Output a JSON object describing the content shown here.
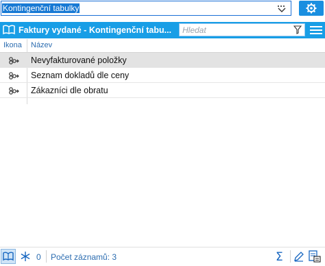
{
  "topbar": {
    "selected_view": "Kontingenční tabulky",
    "dropdown_icon": "filter-dropdown-icon",
    "settings_icon": "gear-icon"
  },
  "header": {
    "title": "Faktury vydané - Kontingenční tabu...",
    "search_placeholder": "Hledat",
    "colors": {
      "header_bg": "#189ee6",
      "accent": "#1a8fe0"
    }
  },
  "grid": {
    "columns": [
      "Ikona",
      "Název"
    ],
    "rows": [
      {
        "icon": "pivot-table-icon",
        "name": "Nevyfakturované položky",
        "selected": true
      },
      {
        "icon": "pivot-table-icon",
        "name": "Seznam dokladů dle ceny",
        "selected": false
      },
      {
        "icon": "pivot-table-icon",
        "name": "Zákazníci dle obratu",
        "selected": false
      }
    ]
  },
  "status": {
    "filter_count": "0",
    "record_count": "Počet záznamů: 3",
    "sigma": "Σ"
  }
}
